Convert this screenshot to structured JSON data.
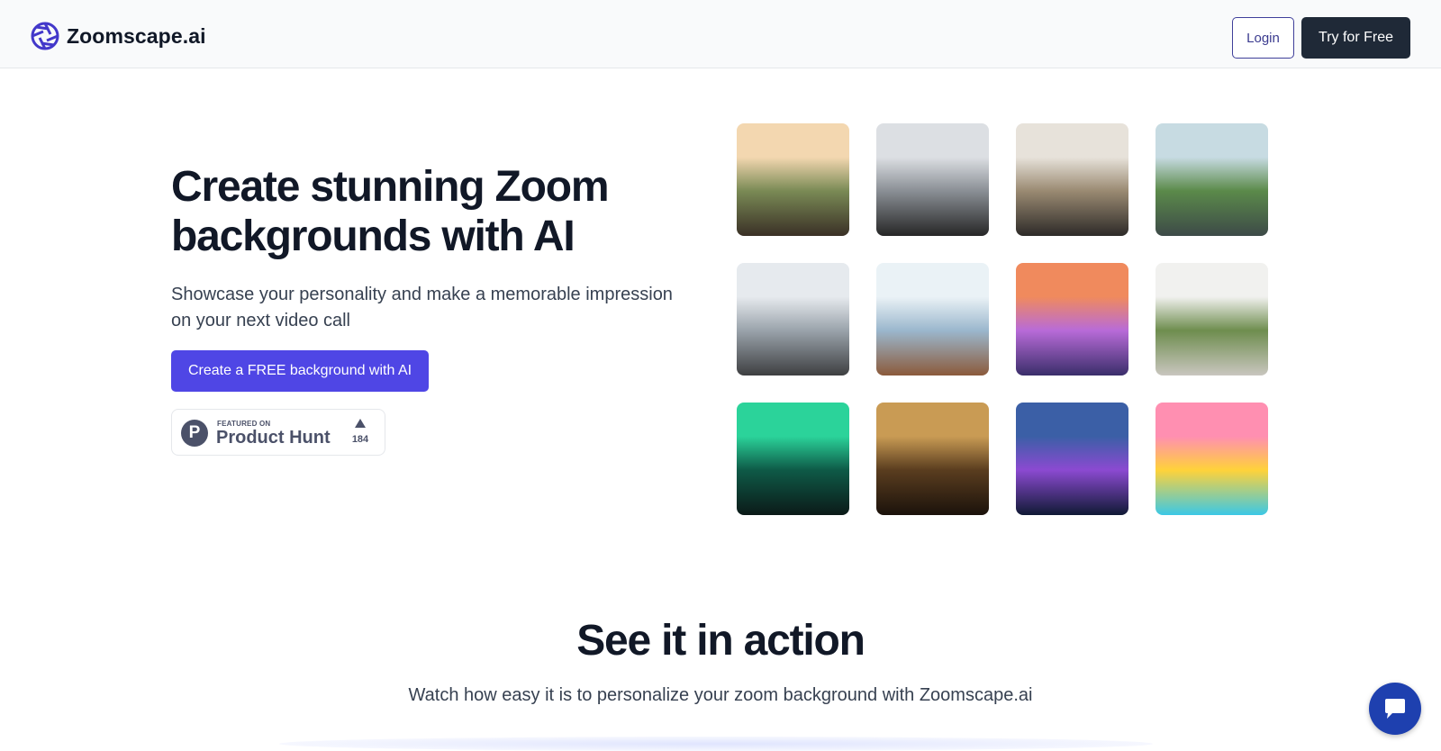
{
  "header": {
    "brand_name": "Zoomscape.ai",
    "logo_icon": "aperture-icon",
    "login_label": "Login",
    "try_label": "Try for Free"
  },
  "hero": {
    "title": "Create stunning Zoom backgrounds with AI",
    "subtitle": "Showcase your personality and make a memorable impression on your next video call",
    "cta_label": "Create a FREE background with AI",
    "product_hunt": {
      "logo_letter": "P",
      "featured_label": "FEATURED ON",
      "name": "Product Hunt",
      "upvote_icon": "triangle-up-icon",
      "upvotes": "184"
    }
  },
  "gallery": {
    "items": [
      {
        "name": "office-forest-thumbnail",
        "palette": [
          "#f3d7b0",
          "#7a8a55",
          "#3a3026"
        ]
      },
      {
        "name": "japanese-room-thumbnail",
        "palette": [
          "#dcdfe3",
          "#8a8f95",
          "#262626"
        ]
      },
      {
        "name": "shelf-living-room-thumbnail",
        "palette": [
          "#e7e2da",
          "#9a8a72",
          "#2d2a28"
        ]
      },
      {
        "name": "lake-view-lounge-thumbnail",
        "palette": [
          "#c7dbe2",
          "#5b8a4a",
          "#3d4a48"
        ]
      },
      {
        "name": "snowy-mountains-thumbnail",
        "palette": [
          "#e6eaee",
          "#9aa3ab",
          "#3e3f41"
        ]
      },
      {
        "name": "winter-lounge-thumbnail",
        "palette": [
          "#eaf2f6",
          "#9bb7cd",
          "#8b5a3b"
        ]
      },
      {
        "name": "retro-neon-room-thumbnail",
        "palette": [
          "#f08a5d",
          "#b86bd8",
          "#3a2e6a"
        ]
      },
      {
        "name": "white-sunroom-thumbnail",
        "palette": [
          "#f1f1ef",
          "#6e8d4e",
          "#c9c6bf"
        ]
      },
      {
        "name": "neon-green-office-thumbnail",
        "palette": [
          "#2bd39a",
          "#0e5a47",
          "#0b1a18"
        ]
      },
      {
        "name": "library-thumbnail",
        "palette": [
          "#c99b54",
          "#5a3d1f",
          "#1b120b"
        ]
      },
      {
        "name": "night-city-penthouse-thumbnail",
        "palette": [
          "#3b5fa6",
          "#8b4ad1",
          "#101a35"
        ]
      },
      {
        "name": "pop-art-desk-thumbnail",
        "palette": [
          "#ff8fb1",
          "#ffd23a",
          "#3bc8e6"
        ]
      }
    ]
  },
  "section": {
    "title": "See it in action",
    "subtitle": "Watch how easy it is to personalize your zoom background with Zoomscape.ai"
  },
  "chat": {
    "icon": "chat-bubble-icon"
  },
  "colors": {
    "accent": "#4f46e5",
    "dark_button": "#1f2937",
    "chat_button": "#1e40af",
    "header_bg": "#f9fafb"
  }
}
